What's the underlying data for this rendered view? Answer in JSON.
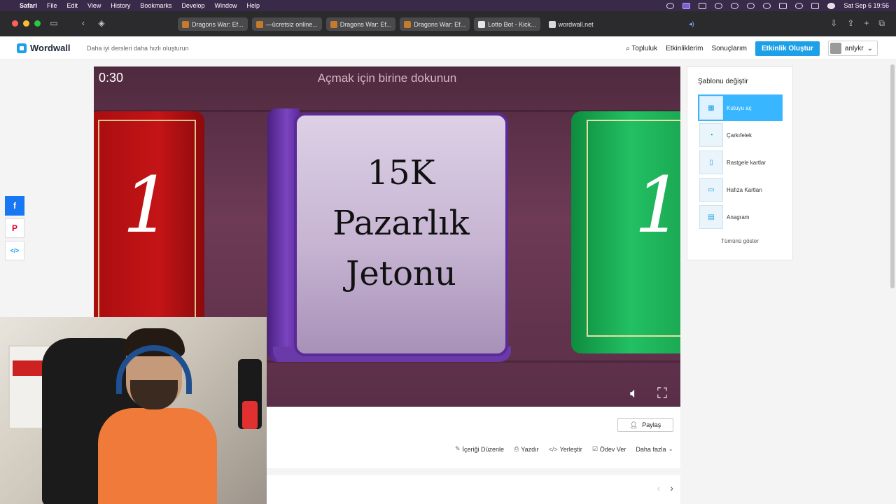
{
  "menubar": {
    "app": "Safari",
    "items": [
      "File",
      "Edit",
      "View",
      "History",
      "Bookmarks",
      "Develop",
      "Window",
      "Help"
    ],
    "clock": "Sat Sep 6  19:56"
  },
  "browser": {
    "tabs": [
      {
        "title": "Dragons War: Ef..."
      },
      {
        "title": "—ücretsiz online..."
      },
      {
        "title": "Dragons War: Ef..."
      },
      {
        "title": "Dragons War: Ef..."
      },
      {
        "title": "Lotto Bot - Kick..."
      }
    ],
    "active_tab": "wordwall.net"
  },
  "header": {
    "logo": "Wordwall",
    "tagline": "Daha iyi dersleri daha hızlı oluşturun",
    "nav": {
      "community": "Topluluk",
      "my_activities": "Etkinliklerim",
      "my_results": "Sonuçlarım",
      "create": "Etkinlik Oluştur",
      "user": "anlykr"
    }
  },
  "game": {
    "timer": "0:30",
    "instruction": "Açmak için birine dokunun",
    "left_book_number": "1",
    "right_book_number": "1",
    "center_book_lines": [
      "15K",
      "Pazarlık",
      "Jetonu"
    ]
  },
  "actions": {
    "share": "Paylaş",
    "edit": "İçeriği Düzenle",
    "print": "Yazdır",
    "embed": "Yerleştir",
    "assign": "Ödev Ver",
    "more": "Daha fazla"
  },
  "templates": {
    "title": "Şablonu değiştir",
    "items": [
      {
        "label": "Kutuyu aç",
        "active": true
      },
      {
        "label": "Çarkıfelek",
        "active": false
      },
      {
        "label": "Rastgele kartlar",
        "active": false
      },
      {
        "label": "Hafıza Kartları",
        "active": false
      },
      {
        "label": "Anagram",
        "active": false
      }
    ],
    "show_all": "Tümünü göster"
  },
  "colors": {
    "accent": "#1ea0e8",
    "template_active": "#38b6ff",
    "menubar": "#3a2a4a"
  },
  "icons": [
    "apple-icon",
    "sidebar-icon",
    "back-icon",
    "shield-icon",
    "search-icon",
    "facebook-icon",
    "pinterest-icon",
    "embed-icon",
    "volume-icon",
    "fullscreen-icon",
    "share-user-icon",
    "pencil-icon",
    "printer-icon",
    "code-icon",
    "check-square-icon",
    "chevron-down-icon",
    "chevron-left-icon",
    "chevron-right-icon"
  ]
}
